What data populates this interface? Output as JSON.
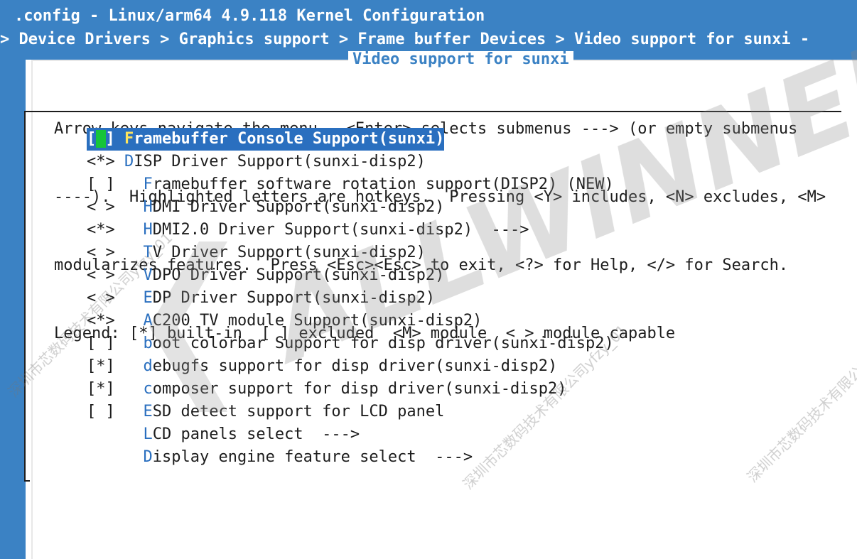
{
  "window": {
    "title": ".config - Linux/arm64 4.9.118 Kernel Configuration",
    "breadcrumb": "> Device Drivers > Graphics support > Frame buffer Devices > Video support for sunxi -"
  },
  "dialog": {
    "title": "Video support for sunxi",
    "help_lines": [
      "Arrow keys navigate the menu.  <Enter> selects submenus ---> (or empty submenus",
      "----).  Highlighted letters are hotkeys.  Pressing <Y> includes, <N> excludes, <M>",
      "modularizes features.  Press <Esc><Esc> to exit, <?> for Help, </> for Search.",
      "Legend: [*] built-in  [ ] excluded  <M> module  < > module capable"
    ]
  },
  "menu": {
    "items": [
      {
        "prefix": "[ ] ",
        "hotkey": "F",
        "rest": "ramebuffer Console Support(sunxi)",
        "indent": "",
        "selected": true
      },
      {
        "prefix": "<*> ",
        "hotkey": "D",
        "rest": "ISP Driver Support(sunxi-disp2)",
        "indent": "",
        "selected": false
      },
      {
        "prefix": "[ ] ",
        "hotkey": "F",
        "rest": "ramebuffer software rotation support(DISP2) (NEW)",
        "indent": "  ",
        "selected": false
      },
      {
        "prefix": "< > ",
        "hotkey": "H",
        "rest": "DMI Driver Support(sunxi-disp2)",
        "indent": "  ",
        "selected": false
      },
      {
        "prefix": "<*> ",
        "hotkey": "H",
        "rest": "DMI2.0 Driver Support(sunxi-disp2)  --->",
        "indent": "  ",
        "selected": false
      },
      {
        "prefix": "< > ",
        "hotkey": "T",
        "rest": "V Driver Support(sunxi-disp2)",
        "indent": "  ",
        "selected": false
      },
      {
        "prefix": "< > ",
        "hotkey": "V",
        "rest": "DPO Driver Support(sunxi-disp2)",
        "indent": "  ",
        "selected": false
      },
      {
        "prefix": "< > ",
        "hotkey": "E",
        "rest": "DP Driver Support(sunxi-disp2)",
        "indent": "  ",
        "selected": false
      },
      {
        "prefix": "<*> ",
        "hotkey": "A",
        "rest": "C200 TV module Support(sunxi-disp2)",
        "indent": "  ",
        "selected": false
      },
      {
        "prefix": "[ ] ",
        "hotkey": "b",
        "rest": "oot colorbar Support for disp driver(sunxi-disp2)",
        "indent": "  ",
        "selected": false
      },
      {
        "prefix": "[*] ",
        "hotkey": "d",
        "rest": "ebugfs support for disp driver(sunxi-disp2)",
        "indent": "  ",
        "selected": false
      },
      {
        "prefix": "[*] ",
        "hotkey": "c",
        "rest": "omposer support for disp driver(sunxi-disp2)",
        "indent": "  ",
        "selected": false
      },
      {
        "prefix": "[ ] ",
        "hotkey": "E",
        "rest": "SD detect support for LCD panel",
        "indent": "  ",
        "selected": false
      },
      {
        "prefix": "    ",
        "hotkey": "L",
        "rest": "CD panels select  --->",
        "indent": "  ",
        "selected": false
      },
      {
        "prefix": "    ",
        "hotkey": "D",
        "rest": "isplay engine feature select  --->",
        "indent": "  ",
        "selected": false
      }
    ]
  },
  "watermark": {
    "logo_text": "ALLWINNER",
    "company_text": "深圳市芯数码技术有限公司yfzy_01"
  },
  "colors": {
    "background": "#3b82c4",
    "highlight": "#2a6fbf",
    "hotkey": "#2a6fbf",
    "cursor": "#16c43a"
  }
}
